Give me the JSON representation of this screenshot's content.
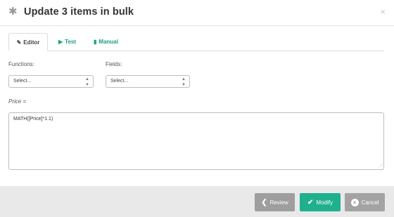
{
  "header": {
    "title": "Update 3 items in bulk",
    "icon": "gear-icon",
    "close_icon": "close-icon",
    "close_glyph": "×"
  },
  "tabs": [
    {
      "label": "Editor",
      "icon": "pencil-icon",
      "active": true
    },
    {
      "label": "Test",
      "icon": "play-icon",
      "active": false
    },
    {
      "label": "Manual",
      "icon": "book-icon",
      "active": false
    }
  ],
  "form": {
    "functions_label": "Functions:",
    "functions_value": "Select...",
    "fields_label": "Fields:",
    "fields_value": "Select...",
    "expression_label": "Price =",
    "expression_value": "MATH([Price]*1.1)"
  },
  "footer": {
    "review_label": "Review",
    "modify_label": "Modify",
    "cancel_label": "Cancel"
  },
  "colors": {
    "accent": "#1fb08d",
    "tab_link": "#1aa386",
    "neutral_button": "#9e9e9e",
    "footer_bg": "#e9e9e9"
  }
}
